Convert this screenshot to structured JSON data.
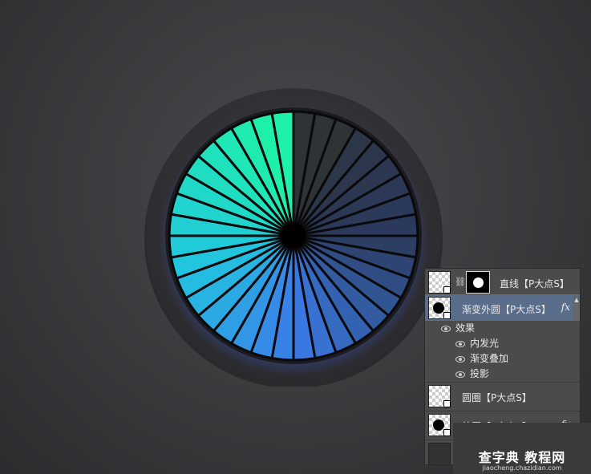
{
  "dial": {
    "segment_count": 36,
    "colors": {
      "green": "#1ef2a8",
      "teal": "#1ed2c8",
      "cyan": "#22b4e6",
      "blue": "#3a7ce8",
      "dark_navy": "#2b3a5c",
      "dark_gray": "#2e3336",
      "outer_ring": "#2b2b2f",
      "bezel": "#1c1c20"
    }
  },
  "layers_panel": {
    "layers": [
      {
        "name": "直线【P大点S】",
        "has_mask": true,
        "has_fx": false,
        "selected": false
      },
      {
        "name": "渐变外圆【P大点S】",
        "has_mask": false,
        "has_fx": true,
        "fx_label": "fx",
        "selected": true
      },
      {
        "name": "圆圈【P大点S】",
        "has_mask": false,
        "has_fx": false,
        "selected": false
      },
      {
        "name": "外圆【P大点S】",
        "has_mask": false,
        "has_fx": true,
        "fx_label": "fx",
        "selected": false
      }
    ],
    "effects": {
      "header": "效果",
      "items": [
        "内发光",
        "渐变叠加",
        "投影"
      ]
    }
  },
  "watermark": {
    "main": "查字典 教程网",
    "sub": "jiaocheng.chazidian.com"
  }
}
